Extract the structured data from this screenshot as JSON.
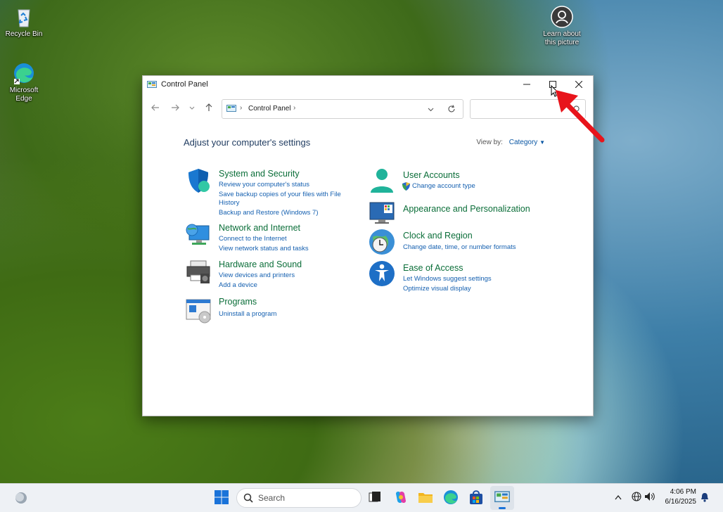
{
  "desktop": {
    "icons": [
      {
        "label": "Recycle Bin"
      },
      {
        "label": "Microsoft Edge"
      },
      {
        "label": "Learn about this picture"
      }
    ]
  },
  "window": {
    "title": "Control Panel",
    "address": "Control Panel",
    "heading": "Adjust your computer's settings",
    "view_by_label": "View by:",
    "view_by_value": "Category",
    "categories": [
      {
        "title": "System and Security",
        "links": [
          "Review your computer's status",
          "Save backup copies of your files with File History",
          "Backup and Restore (Windows 7)"
        ]
      },
      {
        "title": "Network and Internet",
        "links": [
          "Connect to the Internet",
          "View network status and tasks"
        ]
      },
      {
        "title": "Hardware and Sound",
        "links": [
          "View devices and printers",
          "Add a device"
        ]
      },
      {
        "title": "Programs",
        "links": [
          "Uninstall a program"
        ]
      },
      {
        "title": "User Accounts",
        "links": [
          "Change account type"
        ]
      },
      {
        "title": "Appearance and Personalization",
        "links": []
      },
      {
        "title": "Clock and Region",
        "links": [
          "Change date, time, or number formats"
        ]
      },
      {
        "title": "Ease of Access",
        "links": [
          "Let Windows suggest settings",
          "Optimize visual display"
        ]
      }
    ]
  },
  "taskbar": {
    "search_placeholder": "Search",
    "time": "4:06 PM",
    "date": "6/16/2025"
  },
  "colors": {
    "category_title": "#0b6e39",
    "link": "#1560b0",
    "annotation_arrow": "#e8141b"
  }
}
